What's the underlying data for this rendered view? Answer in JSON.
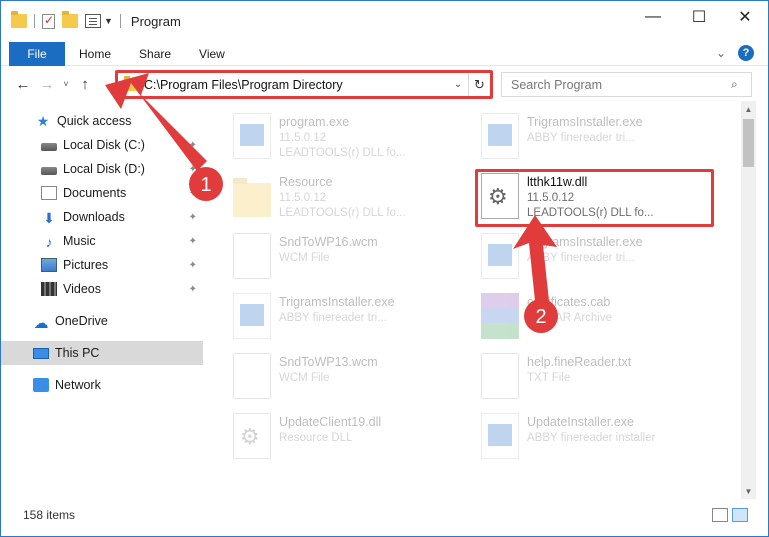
{
  "window": {
    "title": "Program",
    "controls": {
      "minimize": "—",
      "maximize": "☐",
      "close": "✕"
    }
  },
  "ribbon": {
    "file_tab": "File",
    "tabs": [
      "Home",
      "Share",
      "View"
    ]
  },
  "nav": {
    "back": "←",
    "forward": "→",
    "recent": "˅",
    "up": "↑",
    "address": "C:\\Program Files\\Program Directory",
    "refresh": "↻",
    "search_placeholder": "Search Program",
    "search_icon": "⌕"
  },
  "sidebar": {
    "items": [
      {
        "label": "Quick access",
        "icon": "star-icon"
      },
      {
        "label": "Local Disk (C:)",
        "icon": "disk-icon"
      },
      {
        "label": "Local Disk (D:)",
        "icon": "disk-icon"
      },
      {
        "label": "Documents",
        "icon": "documents-icon"
      },
      {
        "label": "Downloads",
        "icon": "download-icon"
      },
      {
        "label": "Music",
        "icon": "music-icon"
      },
      {
        "label": "Pictures",
        "icon": "pictures-icon"
      },
      {
        "label": "Videos",
        "icon": "videos-icon"
      },
      {
        "label": "OneDrive",
        "icon": "cloud-icon"
      },
      {
        "label": "This PC",
        "icon": "pc-icon"
      },
      {
        "label": "Network",
        "icon": "network-icon"
      }
    ]
  },
  "files": [
    {
      "name": "program.exe",
      "meta1": "11.5.0.12",
      "meta2": "LEADTOOLS(r) DLL fo...",
      "icon": "exe-icon"
    },
    {
      "name": "TrigramsInstaller.exe",
      "meta1": "ABBY finereader tri...",
      "meta2": "",
      "icon": "exe-icon"
    },
    {
      "name": "Resource",
      "meta1": "11.5.0.12",
      "meta2": "LEADTOOLS(r) DLL fo...",
      "icon": "folder-icon"
    },
    {
      "name": "ltthk11w.dll",
      "meta1": "11.5.0.12",
      "meta2": "LEADTOOLS(r) DLL fo...",
      "icon": "dll-gear-icon"
    },
    {
      "name": "SndToWP16.wcm",
      "meta1": "WCM File",
      "meta2": "",
      "icon": "document-icon"
    },
    {
      "name": "TrigramsInstaller.exe",
      "meta1": "ABBY finereader tri...",
      "meta2": "",
      "icon": "exe-icon"
    },
    {
      "name": "TrigramsInstaller.exe",
      "meta1": "ABBY finereader tri...",
      "meta2": "",
      "icon": "exe-icon"
    },
    {
      "name": "certificates.cab",
      "meta1": "WinRAR Archive",
      "meta2": "",
      "icon": "archive-icon"
    },
    {
      "name": "SndToWP13.wcm",
      "meta1": "WCM File",
      "meta2": "",
      "icon": "document-icon"
    },
    {
      "name": "help.fineReader.txt",
      "meta1": "TXT File",
      "meta2": "",
      "icon": "document-icon"
    },
    {
      "name": "UpdateClient19.dll",
      "meta1": "Resource DLL",
      "meta2": "",
      "icon": "dll-gear-icon"
    },
    {
      "name": "UpdateInstaller.exe",
      "meta1": "ABBY finereader installer",
      "meta2": "",
      "icon": "exe-icon"
    }
  ],
  "status": {
    "items_count": "158 items"
  },
  "annotations": {
    "badge1": "1",
    "badge2": "2",
    "color": "#e03c3c"
  }
}
